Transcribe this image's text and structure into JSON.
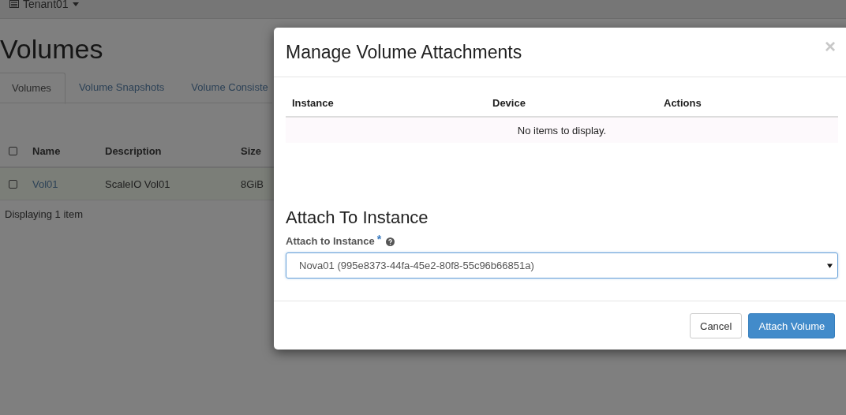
{
  "top_bar": {
    "project": "Tenant01"
  },
  "page": {
    "title": "Volumes",
    "tabs": [
      {
        "label": "Volumes",
        "selected": true
      },
      {
        "label": "Volume Snapshots",
        "selected": false
      },
      {
        "label": "Volume Consiste",
        "selected": false
      }
    ],
    "table": {
      "select_all": {
        "checked": false
      },
      "columns": [
        "Name",
        "Description",
        "Size"
      ],
      "rows": [
        {
          "checked": false,
          "name": "Vol01",
          "description": "ScaleIO Vol01",
          "size": "8GiB"
        }
      ]
    },
    "footer": "Displaying 1 item"
  },
  "modal": {
    "title": "Manage Volume Attachments",
    "close": "×",
    "attachments_table": {
      "columns": [
        "Instance",
        "Device",
        "Actions"
      ],
      "empty_message": "No items to display."
    },
    "section_title": "Attach To Instance",
    "field": {
      "label": "Attach to Instance",
      "required_mark": "*",
      "value": "Nova01 (995e8373-44fa-45e2-80f8-55c96b66851a)"
    },
    "buttons": [
      {
        "label": "Cancel",
        "kind": "default"
      },
      {
        "label": "Attach Volume",
        "kind": "primary"
      }
    ]
  }
}
